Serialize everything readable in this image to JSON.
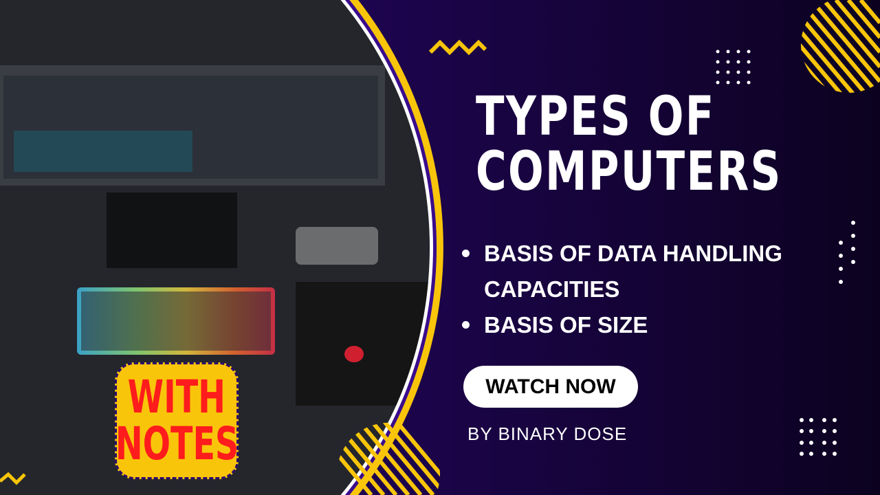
{
  "title_lines": [
    "TYPES OF",
    "COMPUTERS"
  ],
  "bullets": [
    "BASIS OF DATA HANDLING CAPACITIES",
    "BASIS OF SIZE"
  ],
  "cta_label": "WATCH NOW",
  "byline": "BY BINARY DOSE",
  "badge_lines": [
    "WITH",
    "NOTES"
  ],
  "colors": {
    "background": "#13032e",
    "accent_yellow": "#f9c50a",
    "badge_text": "#fe1c1c",
    "purple": "#3a0c8c"
  },
  "photo": "computer-desk-photo"
}
